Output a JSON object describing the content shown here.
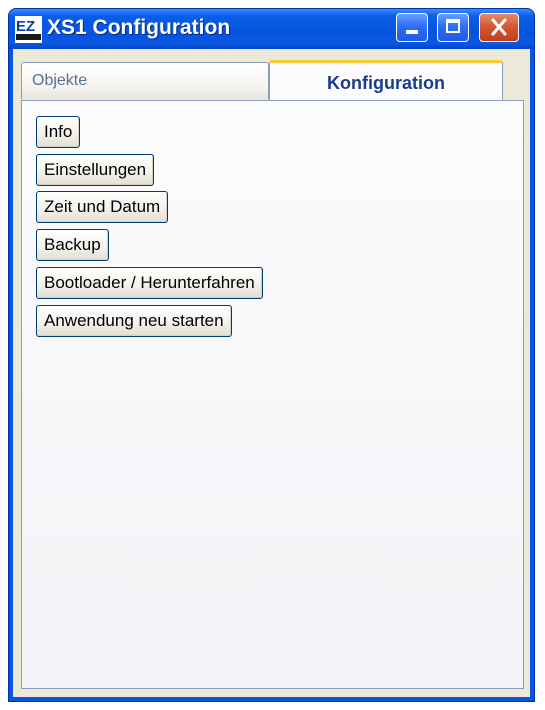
{
  "window": {
    "title": "XS1 Configuration",
    "logo_icon": "ezcontrol-logo-icon",
    "controls": [
      "minimize-icon",
      "maximize-icon",
      "close-icon"
    ]
  },
  "tabs": [
    {
      "label": "Objekte",
      "active": false
    },
    {
      "label": "Konfiguration",
      "active": true
    }
  ],
  "konfiguration": {
    "buttons": [
      {
        "label": "Info"
      },
      {
        "label": "Einstellungen"
      },
      {
        "label": "Zeit und Datum"
      },
      {
        "label": "Backup"
      },
      {
        "label": "Bootloader / Herunterfahren"
      },
      {
        "label": "Anwendung neu starten"
      }
    ]
  },
  "colors": {
    "titlebar": "#0553dd",
    "active_tab_accent": "#ffc83c",
    "client_background": "#ece9d8"
  }
}
